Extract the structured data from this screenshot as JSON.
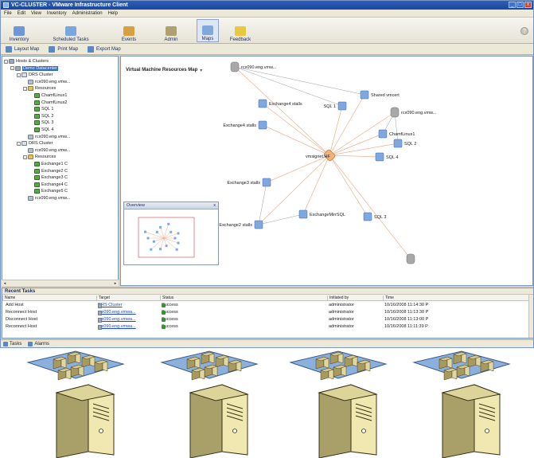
{
  "window": {
    "title": "VC-CLUSTER - VMware Infrastructure Client",
    "controls": [
      "_",
      "□",
      "x"
    ]
  },
  "menu": [
    "File",
    "Edit",
    "View",
    "Inventory",
    "Administration",
    "Help"
  ],
  "toolbar": {
    "buttons": [
      {
        "label": "Inventory",
        "color": "#6f96d8"
      },
      {
        "label": "Scheduled Tasks",
        "color": "#7aa6e0"
      },
      {
        "label": "Events",
        "color": "#d8a040"
      },
      {
        "label": "Admin",
        "color": "#b0a070"
      },
      {
        "label": "Maps",
        "color": "#7fa8dc"
      },
      {
        "label": "Feedback",
        "color": "#e8c840"
      }
    ],
    "help": "?"
  },
  "map_toolbar": [
    "Layout Map",
    "Print Map",
    "Export Map"
  ],
  "tree": {
    "items": [
      {
        "label": "Hosts & Clusters",
        "kind": "dc",
        "level": 0
      },
      {
        "label": "Demo Datacenter",
        "kind": "dc",
        "level": 1,
        "selected": true
      },
      {
        "label": "DRS Cluster",
        "kind": "cl",
        "level": 2
      },
      {
        "label": "rcx090.eng.vmw...",
        "kind": "host",
        "level": 3
      },
      {
        "label": "Resources",
        "kind": "rp",
        "level": 3
      },
      {
        "label": "ChamfLinux1",
        "kind": "vm",
        "level": 4
      },
      {
        "label": "ChamfLinux2",
        "kind": "vm",
        "level": 4
      },
      {
        "label": "SQL 1",
        "kind": "vm",
        "level": 4
      },
      {
        "label": "SQL 2",
        "kind": "vm",
        "level": 4
      },
      {
        "label": "SQL 3",
        "kind": "vm",
        "level": 4
      },
      {
        "label": "SQL 4",
        "kind": "vm",
        "level": 4
      },
      {
        "label": "rcx090.eng.vmw...",
        "kind": "host",
        "level": 3
      },
      {
        "label": "DRS Cluster",
        "kind": "cl",
        "level": 2
      },
      {
        "label": "rcx090.eng.vmw...",
        "kind": "host",
        "level": 3
      },
      {
        "label": "Resources",
        "kind": "rp",
        "level": 3
      },
      {
        "label": "Exchange1 C",
        "kind": "vm",
        "level": 4
      },
      {
        "label": "Exchange2 C",
        "kind": "vm",
        "level": 4
      },
      {
        "label": "Exchange3 C",
        "kind": "vm",
        "level": 4
      },
      {
        "label": "Exchange4 C",
        "kind": "vm",
        "level": 4
      },
      {
        "label": "Exchange5 C",
        "kind": "vm",
        "level": 4
      },
      {
        "label": "rcx090.eng.vmw...",
        "kind": "host",
        "level": 3
      }
    ]
  },
  "map": {
    "title": "Virtual Machine Resources Map",
    "dropdown": "▾",
    "center": {
      "label": "vmsignet.HF"
    },
    "nodes": [
      {
        "label": "rcx090.eng.vmw...",
        "kind": "host"
      },
      {
        "label": "Exchange4 stalls",
        "kind": "vm"
      },
      {
        "label": "SQL 1",
        "kind": "vm"
      },
      {
        "label": "Shared vmcert",
        "kind": "vm"
      },
      {
        "label": "rcx090.eng.vmw...",
        "kind": "host"
      },
      {
        "label": "Exchange4 stalls",
        "kind": "vm"
      },
      {
        "label": "ChamfLinux1",
        "kind": "vm"
      },
      {
        "label": "SQL 2",
        "kind": "vm"
      },
      {
        "label": "SQL 4",
        "kind": "vm"
      },
      {
        "label": "Exchange3 stalls",
        "kind": "vm"
      },
      {
        "label": "Exchange2 stalls",
        "kind": "vm"
      },
      {
        "label": "ExchangeMirrSQL",
        "kind": "vm"
      },
      {
        "label": "SQL 3",
        "kind": "vm"
      },
      {
        "label": "",
        "kind": "host"
      }
    ]
  },
  "overview": {
    "title": "Overview",
    "close": "x"
  },
  "tasks": {
    "title": "Recent Tasks",
    "columns": [
      "Name",
      "Target",
      "Status",
      "Initiated by",
      "Time"
    ],
    "rows": [
      {
        "name": "Add Host",
        "target": "DRS Cluster",
        "status": "Success",
        "by": "administrator",
        "time": "10/16/2008 11:14:30 P"
      },
      {
        "name": "Reconnect Host",
        "target": "rcx090.eng.vmwa...",
        "status": "Success",
        "by": "administrator",
        "time": "10/16/2008 11:13:30 P"
      },
      {
        "name": "Disconnect Host",
        "target": "rcx090.eng.vmwa...",
        "status": "Success",
        "by": "administrator",
        "time": "10/16/2008 11:13:00 P"
      },
      {
        "name": "Reconnect Host",
        "target": "rcx090.eng.vmwa...",
        "status": "Success",
        "by": "administrator",
        "time": "10/16/2008 11:11:39 P"
      }
    ]
  },
  "statusbar": [
    "Tasks",
    "Alarms"
  ],
  "colors": {
    "accent": "#316ac5",
    "vm_icon": "#7fa8e0",
    "host_icon": "#a8a8a8",
    "edge": "#f0b090",
    "success": "#2e9a2e",
    "server_body": "#f0e8b0",
    "server_shadow": "#a8a068",
    "tray": "#8cb0dc"
  }
}
